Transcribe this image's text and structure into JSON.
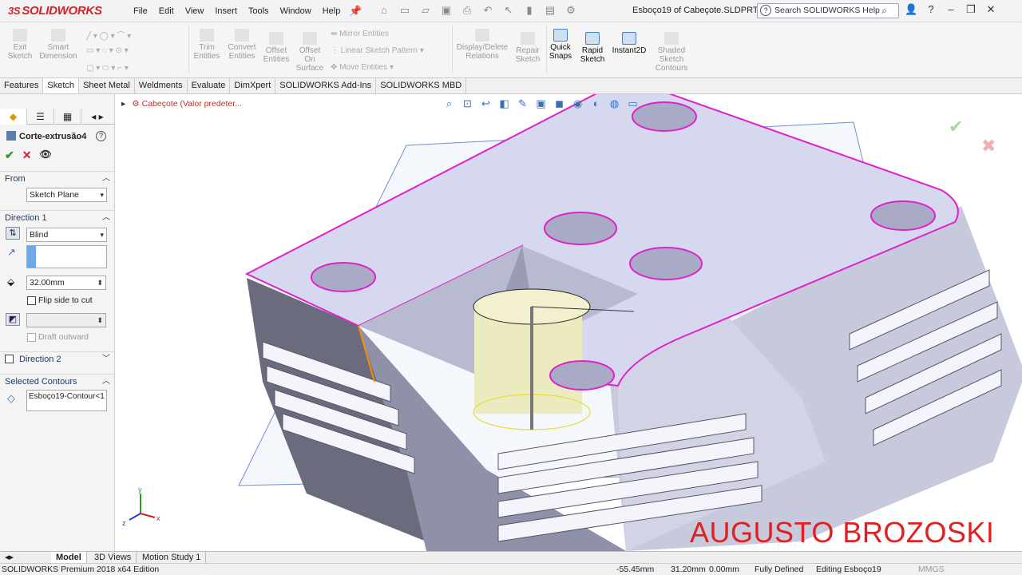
{
  "app": {
    "logo": "SOLIDWORKS",
    "logo_mark": "3S",
    "doc_title": "Esboço19 of Cabeçote.SLDPRT *"
  },
  "menu": [
    "File",
    "Edit",
    "View",
    "Insert",
    "Tools",
    "Window",
    "Help"
  ],
  "search": {
    "placeholder": "Search SOLIDWORKS Help"
  },
  "ribbon": {
    "exit_sketch": "Exit\nSketch",
    "smart_dimension": "Smart\nDimension",
    "trim": "Trim\nEntities",
    "convert": "Convert\nEntities",
    "offset": "Offset\nEntities",
    "offset_surface": "Offset\nOn\nSurface",
    "mirror": "Mirror Entities",
    "linear_pattern": "Linear Sketch Pattern",
    "move": "Move Entities",
    "display_delete": "Display/Delete\nRelations",
    "repair": "Repair\nSketch",
    "quick_snaps": "Quick\nSnaps",
    "rapid_sketch": "Rapid\nSketch",
    "instant2d": "Instant2D",
    "shaded_contours": "Shaded\nSketch\nContours"
  },
  "command_tabs": [
    "Features",
    "Sketch",
    "Sheet Metal",
    "Weldments",
    "Evaluate",
    "DimXpert",
    "SOLIDWORKS Add-Ins",
    "SOLIDWORKS MBD"
  ],
  "active_tab": "Sketch",
  "property_manager": {
    "title": "Corte-extrusão4",
    "from_label": "From",
    "from_value": "Sketch Plane",
    "dir1_label": "Direction 1",
    "end_condition": "Blind",
    "depth": "32.00mm",
    "flip_label": "Flip side to cut",
    "draft_label": "Draft outward",
    "dir2_label": "Direction 2",
    "contours_label": "Selected Contours",
    "contour_value": "Esboço19-Contour<1"
  },
  "canvas": {
    "breadcrumb": "Cabeçote  (Valor predeter...",
    "watermark": "AUGUSTO BROZOSKI",
    "triad": {
      "x": "x",
      "y": "y",
      "z": "z"
    }
  },
  "bottom_tabs": [
    "Model",
    "3D Views",
    "Motion Study 1"
  ],
  "status": {
    "edition": "SOLIDWORKS Premium 2018 x64 Edition",
    "x": "-55.45mm",
    "y": "31.20mm",
    "z": "0.00mm",
    "state": "Fully Defined",
    "editing": "Editing Esboço19",
    "units": "MMGS"
  },
  "colors": {
    "brand": "#d2232a",
    "sketch_edge": "#e020c8",
    "model_face": "#d6d8f0",
    "accent": "#3a6fb5"
  }
}
